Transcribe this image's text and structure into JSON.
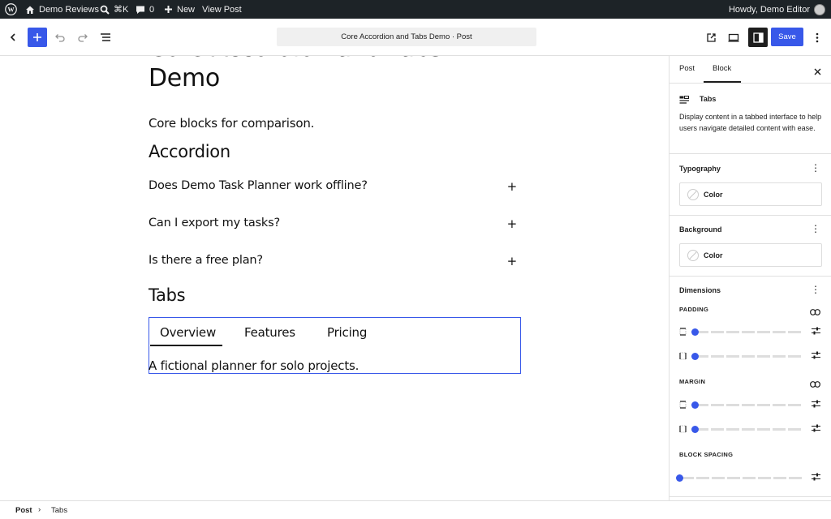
{
  "admin_bar": {
    "site_name": "Demo Reviews",
    "search_shortcut": "⌘K",
    "comments_count": "0",
    "new_label": "New",
    "view_post_label": "View Post",
    "greeting": "Howdy, Demo Editor"
  },
  "toolbar": {
    "document_title": "Core Accordion and Tabs Demo · Post",
    "save_label": "Save"
  },
  "content": {
    "post_title": "Core Accordion and Tabs Demo",
    "intro": "Core blocks for comparison.",
    "accordion_heading": "Accordion",
    "accordion_items": [
      {
        "question": "Does Demo Task Planner work offline?",
        "icon": "+"
      },
      {
        "question": "Can I export my tasks?",
        "icon": "+"
      },
      {
        "question": "Is there a free plan?",
        "icon": "+"
      }
    ],
    "tabs_heading": "Tabs",
    "tabs": [
      {
        "label": "Overview",
        "active": true
      },
      {
        "label": "Features",
        "active": false
      },
      {
        "label": "Pricing",
        "active": false
      }
    ],
    "tab_panel_text": "A fictional planner for solo projects."
  },
  "sidebar": {
    "tabs": [
      {
        "label": "Post",
        "active": false
      },
      {
        "label": "Block",
        "active": true
      }
    ],
    "block_name": "Tabs",
    "block_description": "Display content in a tabbed interface to help users navigate detailed content with ease.",
    "typography": {
      "heading": "Typography",
      "color_label": "Color"
    },
    "background": {
      "heading": "Background",
      "color_label": "Color"
    },
    "dimensions": {
      "heading": "Dimensions",
      "padding_label": "PADDING",
      "margin_label": "MARGIN",
      "block_spacing_label": "BLOCK SPACING",
      "padding_values": [
        0,
        0
      ],
      "margin_values": [
        0,
        0
      ],
      "block_spacing_value": 0
    }
  },
  "breadcrumb": {
    "root": "Post",
    "separator": "›",
    "current": "Tabs"
  },
  "colors": {
    "accent": "#3858e9",
    "admin_bar": "#1d2327"
  },
  "icons": [
    "wordpress-logo-icon",
    "home-icon",
    "search-icon",
    "comment-icon",
    "plus-icon",
    "back-icon",
    "undo-icon",
    "redo-icon",
    "list-view-icon",
    "external-link-icon",
    "desktop-icon",
    "sidebar-icon",
    "more-vertical-icon",
    "close-icon",
    "tabs-block-icon",
    "link-icon",
    "tune-icon"
  ]
}
